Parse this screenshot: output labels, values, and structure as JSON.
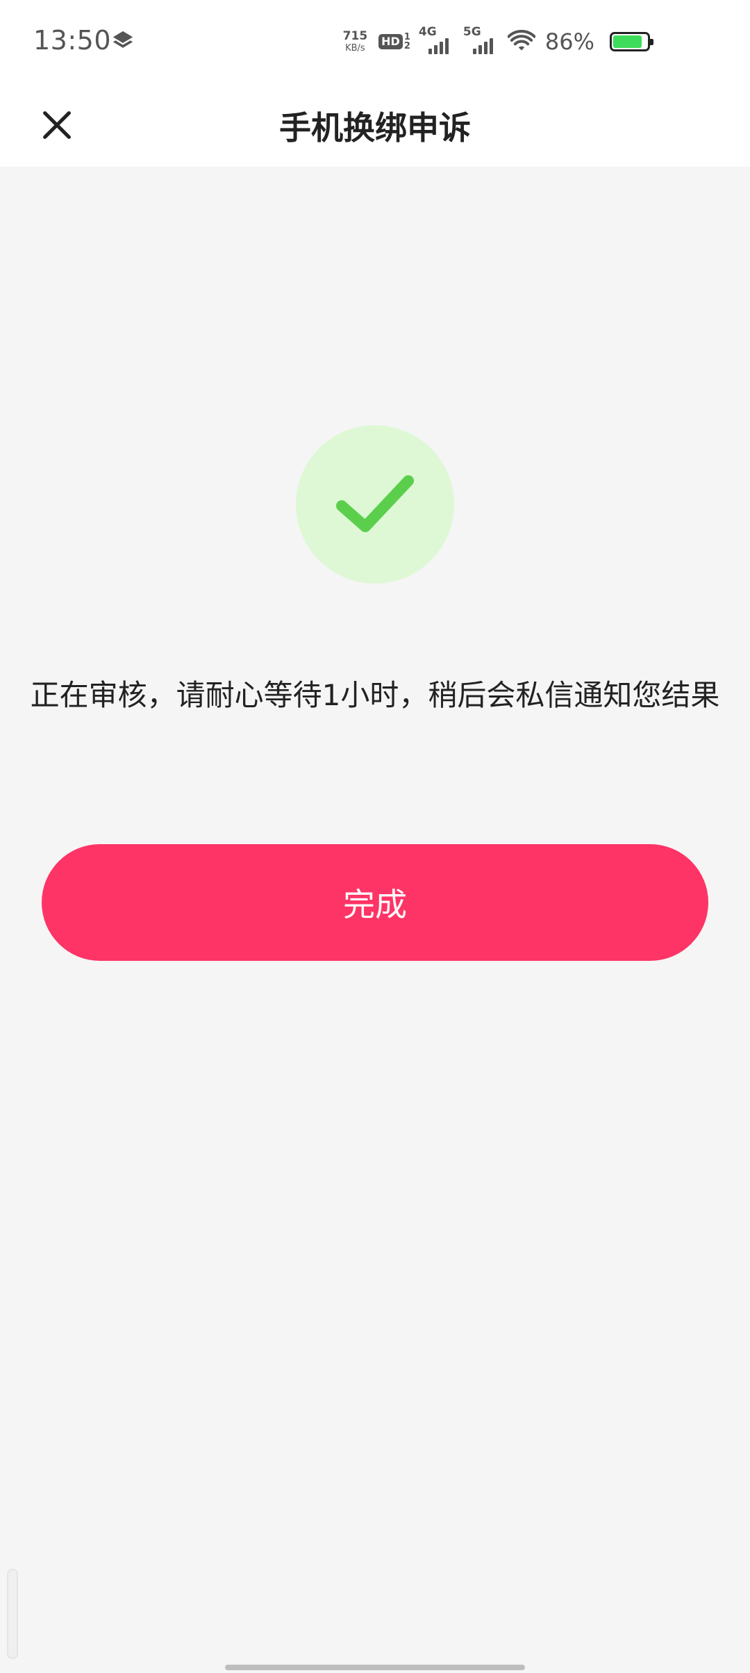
{
  "status_bar": {
    "time": "13:50",
    "net_speed_value": "715",
    "net_speed_unit": "KB/s",
    "hd_label": "HD",
    "hd_sub_top": "1",
    "hd_sub_bottom": "2",
    "signal_1_label": "4G",
    "signal_2_label": "5G",
    "battery_percent": "86%",
    "battery_level": 0.86,
    "battery_color": "#3ddc5a"
  },
  "nav": {
    "close_icon": "close-icon",
    "title": "手机换绑申诉"
  },
  "result": {
    "icon": "checkmark-icon",
    "icon_color": "#5bcf4c",
    "icon_bg_color": "#def8d6",
    "message": "正在审核，请耐心等待1小时，稍后会私信通知您结果"
  },
  "actions": {
    "done_label": "完成",
    "done_color": "#fe3466"
  }
}
